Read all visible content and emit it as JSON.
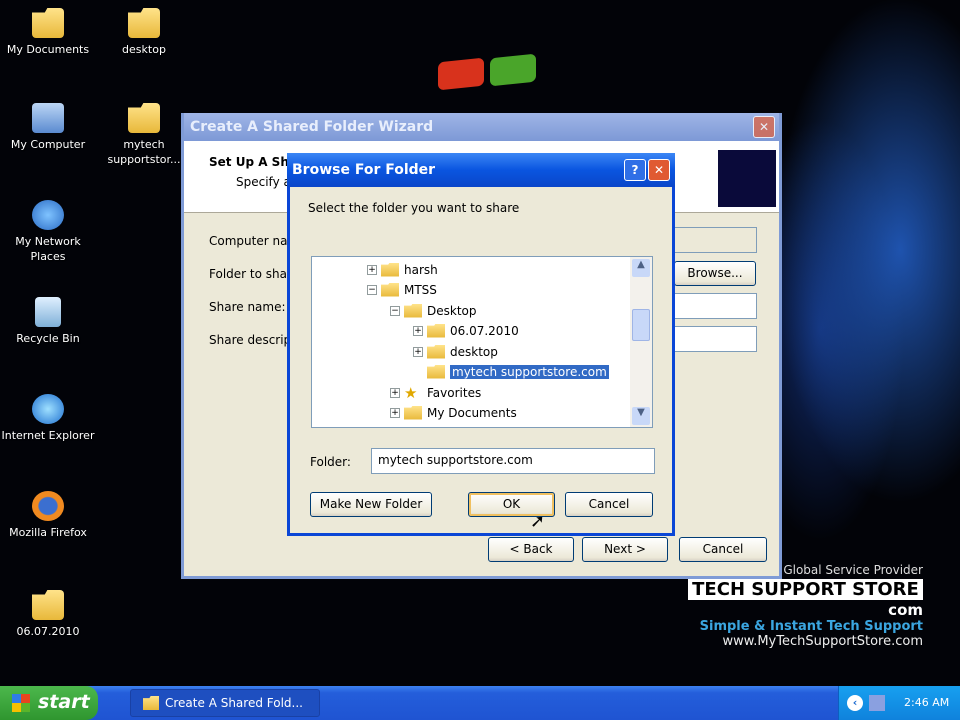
{
  "desktop": {
    "icons": [
      {
        "label": "My Documents",
        "icon": "my-documents-icon"
      },
      {
        "label": "desktop",
        "icon": "folder-icon"
      },
      {
        "label": "My Computer",
        "icon": "my-computer-icon"
      },
      {
        "label": "mytech supportstor...",
        "icon": "folder-icon"
      },
      {
        "label": "My Network Places",
        "icon": "network-places-icon"
      },
      {
        "label": "Recycle Bin",
        "icon": "recycle-bin-icon"
      },
      {
        "label": "Internet Explorer",
        "icon": "internet-explorer-icon"
      },
      {
        "label": "Mozilla Firefox",
        "icon": "firefox-icon"
      },
      {
        "label": "06.07.2010",
        "icon": "folder-icon"
      }
    ]
  },
  "wizard": {
    "title": "Create A Shared Folder Wizard",
    "header_title": "Set Up A Sh",
    "header_sub": "Specify a",
    "computer_name_label": "Computer na",
    "folder_label": "Folder to sha",
    "share_name_label": "Share name:",
    "share_desc_label": "Share descrip",
    "browse": "Browse...",
    "back": "< Back",
    "next": "Next >",
    "cancel": "Cancel"
  },
  "browse_dialog": {
    "title": "Browse For Folder",
    "prompt": "Select the folder you want to share",
    "tree": [
      {
        "label": "harsh",
        "expander": "+",
        "icon": "folder-icon"
      },
      {
        "label": "MTSS",
        "expander": "−",
        "icon": "folder-icon"
      },
      {
        "label": "Desktop",
        "expander": "−",
        "icon": "folder-icon"
      },
      {
        "label": "06.07.2010",
        "expander": "+",
        "icon": "folder-icon"
      },
      {
        "label": "desktop",
        "expander": "+",
        "icon": "folder-icon"
      },
      {
        "label": "mytech supportstore.com",
        "expander": "",
        "icon": "folder-icon",
        "selected": true
      },
      {
        "label": "Favorites",
        "expander": "+",
        "icon": "star-icon"
      },
      {
        "label": "My Documents",
        "expander": "+",
        "icon": "folder-icon"
      }
    ],
    "folder_label": "Folder:",
    "folder_value": "mytech supportstore.com",
    "make_new_folder": "Make New Folder",
    "ok": "OK",
    "cancel": "Cancel"
  },
  "watermark": {
    "tagline1": "Global Service Provider",
    "brand": "TECH SUPPORT STORE",
    "brand_suffix": "com",
    "tagline2": "Simple & Instant Tech Support",
    "url": "www.MyTechSupportStore.com"
  },
  "taskbar": {
    "start": "start",
    "task": "Create A Shared Fold...",
    "clock": "2:46 AM"
  },
  "colors": {
    "title_active": "#0a55e0",
    "selection": "#316ac5",
    "taskbar": "#245edb",
    "start": "#2f962f"
  }
}
